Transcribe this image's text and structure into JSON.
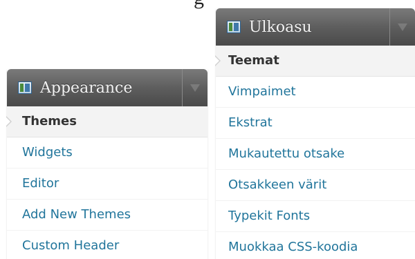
{
  "top_caption": "g",
  "menus": [
    {
      "title": "Appearance",
      "icon": "appearance-icon",
      "toggle_icon": "chevron-down-icon",
      "items": [
        {
          "label": "Themes",
          "current": true
        },
        {
          "label": "Widgets",
          "current": false
        },
        {
          "label": "Editor",
          "current": false
        },
        {
          "label": "Add New Themes",
          "current": false
        },
        {
          "label": "Custom Header",
          "current": false
        }
      ]
    },
    {
      "title": "Ulkoasu",
      "icon": "appearance-icon",
      "toggle_icon": "chevron-down-icon",
      "items": [
        {
          "label": "Teemat",
          "current": true
        },
        {
          "label": "Vimpaimet",
          "current": false
        },
        {
          "label": "Ekstrat",
          "current": false
        },
        {
          "label": "Mukautettu otsake",
          "current": false
        },
        {
          "label": "Otsakkeen värit",
          "current": false
        },
        {
          "label": "Typekit Fonts",
          "current": false
        },
        {
          "label": "Muokkaa CSS-koodia",
          "current": false
        }
      ]
    }
  ],
  "colors": {
    "link": "#21759b",
    "current_text": "#333333",
    "header_bg": "#5e5e5e"
  }
}
